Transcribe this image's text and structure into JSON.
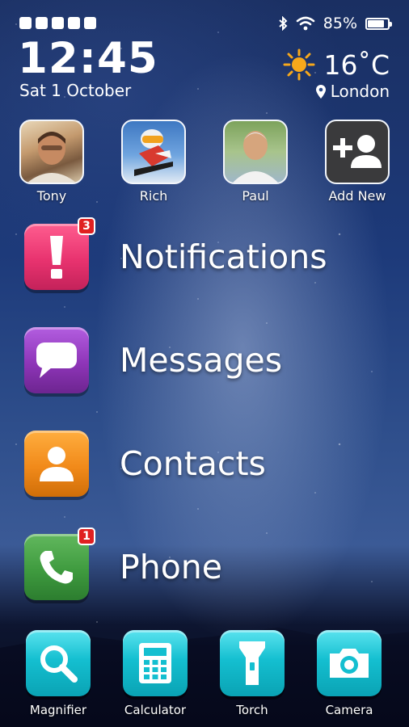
{
  "status": {
    "battery_percent": "85%",
    "battery_level": 0.85,
    "signal_bars": 5
  },
  "clock": {
    "time": "12:45",
    "date": "Sat 1 October"
  },
  "weather": {
    "icon": "sun-icon",
    "temperature": "16˚C",
    "location": "London"
  },
  "favorites": [
    {
      "label": "Tony",
      "icon": "contact-photo"
    },
    {
      "label": "Rich",
      "icon": "contact-photo"
    },
    {
      "label": "Paul",
      "icon": "contact-photo"
    },
    {
      "label": "Add New",
      "icon": "add-contact-icon"
    }
  ],
  "apps": [
    {
      "label": "Notifications",
      "icon": "exclamation-icon",
      "color": "#e8336f",
      "badge": "3"
    },
    {
      "label": "Messages",
      "icon": "speech-bubble-icon",
      "color": "#8e35b8",
      "badge": ""
    },
    {
      "label": "Contacts",
      "icon": "person-icon",
      "color": "#f18a1a",
      "badge": ""
    },
    {
      "label": "Phone",
      "icon": "phone-icon",
      "color": "#3f9b3f",
      "badge": "1"
    }
  ],
  "dock": [
    {
      "label": "Magnifier",
      "icon": "magnifier-icon"
    },
    {
      "label": "Calculator",
      "icon": "calculator-icon"
    },
    {
      "label": "Torch",
      "icon": "torch-icon"
    },
    {
      "label": "Camera",
      "icon": "camera-icon"
    }
  ],
  "colors": {
    "dock_accent": "#14bfd0",
    "badge_red": "#e02020"
  }
}
